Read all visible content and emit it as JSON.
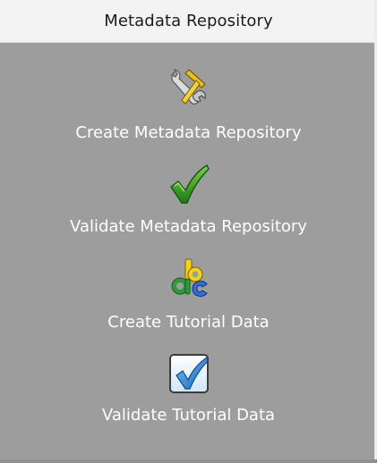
{
  "header": {
    "title": "Metadata Repository"
  },
  "tasks": [
    {
      "label": "Create Metadata Repository",
      "icon": "tools-wrench-hammer-icon"
    },
    {
      "label": "Validate Metadata Repository",
      "icon": "green-checkmark-icon"
    },
    {
      "label": "Create Tutorial Data",
      "icon": "abc-letters-icon"
    },
    {
      "label": "Validate Tutorial Data",
      "icon": "checkbox-checkmark-icon"
    }
  ],
  "colors": {
    "background": "#9d9d9d",
    "header_background": "#f3f3f3",
    "label_text": "#ffffff",
    "check_green": "#3da82b",
    "check_blue": "#3a8fd6"
  }
}
